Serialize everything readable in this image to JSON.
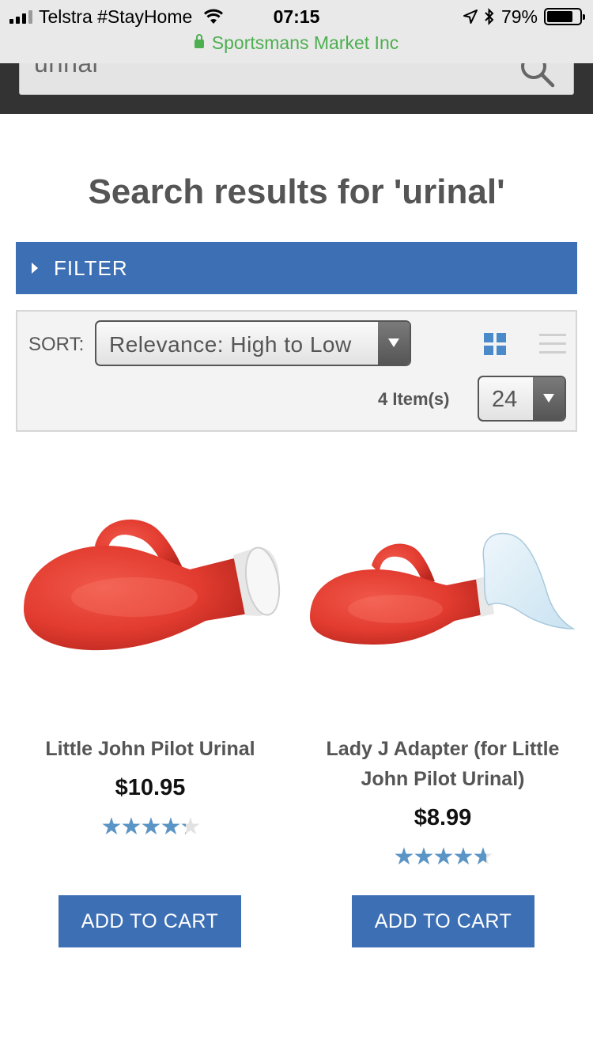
{
  "status_bar": {
    "carrier": "Telstra #StayHome",
    "time": "07:15",
    "battery": "79%",
    "battery_level": 0.79,
    "site": "Sportsmans Market Inc"
  },
  "search": {
    "query": "urinal",
    "icon": "search-icon"
  },
  "page": {
    "title": "Search results for 'urinal'"
  },
  "filter": {
    "label": "FILTER"
  },
  "toolbar": {
    "sort_label": "SORT:",
    "sort_value": "Relevance: High to Low",
    "item_count": "4 Item(s)",
    "per_page": "24",
    "accent_color": "#3d6fb5"
  },
  "products": [
    {
      "name": "Little John Pilot Urinal",
      "price": "$10.95",
      "rating": 4.3,
      "button": "ADD TO CART"
    },
    {
      "name": "Lady J Adapter (for Little John Pilot Urinal)",
      "price": "$8.99",
      "rating": 4.7,
      "button": "ADD TO CART"
    }
  ]
}
